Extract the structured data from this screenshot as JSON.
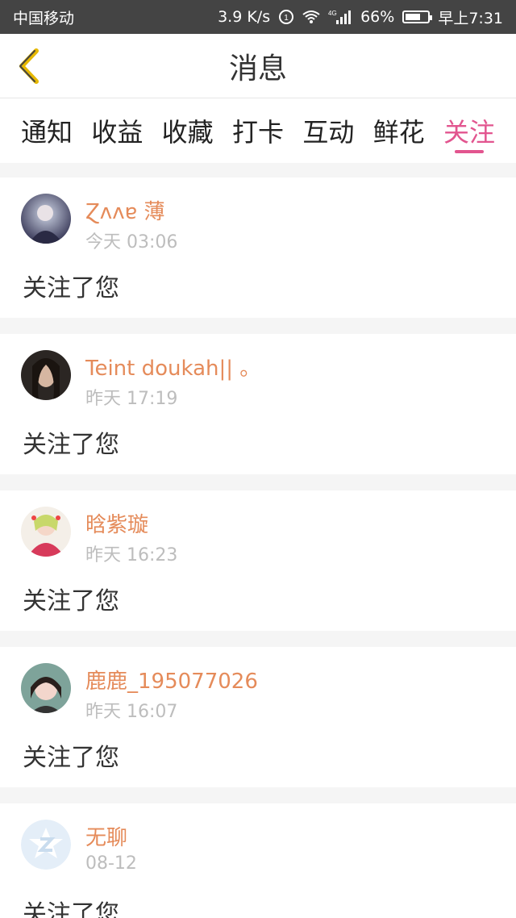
{
  "status": {
    "carrier": "中国移动",
    "speed": "3.9 K/s",
    "network": "4G",
    "battery": "66%",
    "time": "早上7:31"
  },
  "header": {
    "title": "消息"
  },
  "tabs": [
    {
      "label": "通知"
    },
    {
      "label": "收益"
    },
    {
      "label": "收藏"
    },
    {
      "label": "打卡"
    },
    {
      "label": "互动"
    },
    {
      "label": "鲜花"
    },
    {
      "label": "关注"
    }
  ],
  "items": [
    {
      "name": "Ɀʌʌɐ 薄",
      "time": "今天 03:06",
      "text": "关注了您"
    },
    {
      "name": "Teint doukah|| 。",
      "time": "昨天 17:19",
      "text": "关注了您"
    },
    {
      "name": "晗紫璇",
      "time": "昨天 16:23",
      "text": "关注了您"
    },
    {
      "name": "鹿鹿_195077026",
      "time": "昨天 16:07",
      "text": "关注了您"
    },
    {
      "name": "无聊",
      "time": "08-12",
      "text": "关注了您"
    }
  ]
}
